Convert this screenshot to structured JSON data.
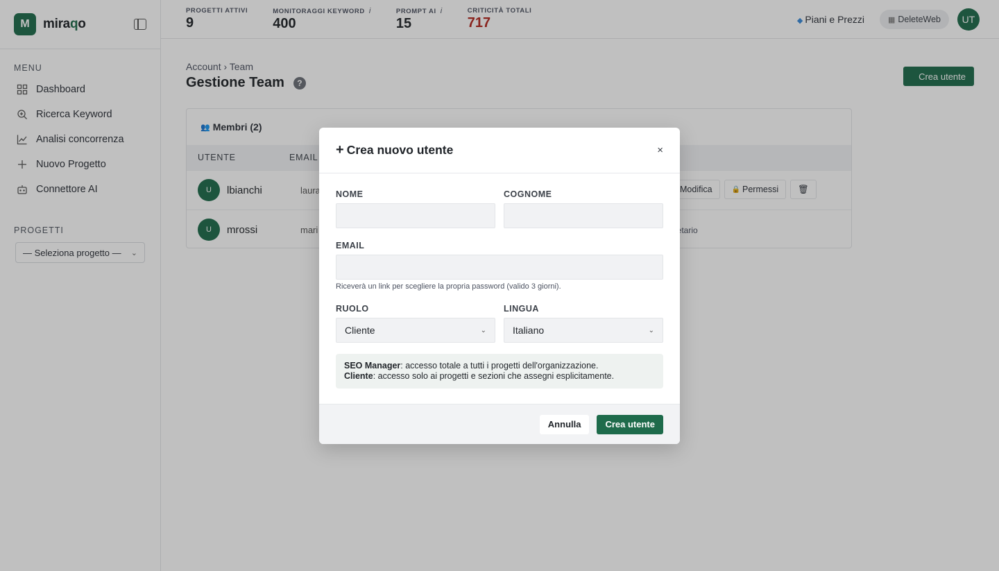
{
  "brand": {
    "logo_letter": "M",
    "name_prefix": "mira",
    "name_accent": "q",
    "name_suffix": "o",
    "accent_color": "#1e6b4b"
  },
  "sidebar": {
    "menu_label": "MENU",
    "items": [
      {
        "label": "Dashboard",
        "icon": "grid-icon"
      },
      {
        "label": "Ricerca Keyword",
        "icon": "search-plus-icon"
      },
      {
        "label": "Analisi concorrenza",
        "icon": "chart-line-icon"
      },
      {
        "label": "Nuovo Progetto",
        "icon": "plus-icon"
      },
      {
        "label": "Connettore AI",
        "icon": "robot-icon"
      }
    ],
    "projects_label": "PROGETTI",
    "project_select": "— Seleziona progetto —"
  },
  "topbar": {
    "stats": [
      {
        "label": "PROGETTI ATTIVI",
        "value": "9",
        "info": ""
      },
      {
        "label": "MONITORAGGI KEYWORD",
        "value": "400",
        "info": "i"
      },
      {
        "label": "PROMPT AI",
        "value": "15",
        "info": "i"
      },
      {
        "label": "CRITICITÀ TOTALI",
        "value": "717",
        "info": "",
        "color": "#b3261e"
      }
    ],
    "plans_label": "Piani e Prezzi",
    "workspace_label": "DeleteWeb",
    "avatar_initials": "UT"
  },
  "page": {
    "breadcrumb": "Account › Team",
    "title": "Gestione Team",
    "create_button": "Crea utente",
    "members_heading": "Membri (2)",
    "columns": [
      "UTENTE",
      "EMAIL"
    ],
    "rows": [
      {
        "initial": "U",
        "username": "lbianchi",
        "email_partial": "laura",
        "actions": [
          "Modifica",
          "Permessi"
        ]
      },
      {
        "initial": "U",
        "username": "mrossi",
        "email_partial": "mari",
        "role_partial": "rietario"
      }
    ]
  },
  "modal": {
    "title": "Crea nuovo utente",
    "close": "×",
    "fields": {
      "nome_label": "NOME",
      "nome_value": "",
      "cognome_label": "COGNOME",
      "cognome_value": "",
      "email_label": "EMAIL",
      "email_value": "",
      "email_hint": "Riceverà un link per scegliere la propria password (valido 3 giorni).",
      "ruolo_label": "RUOLO",
      "ruolo_value": "Cliente",
      "lingua_label": "LINGUA",
      "lingua_value": "Italiano"
    },
    "role_info": {
      "seo_term": "SEO Manager",
      "seo_desc": ": accesso totale a tutti i progetti dell'organizzazione.",
      "client_term": "Cliente",
      "client_desc": ": accesso solo ai progetti e sezioni che assegni esplicitamente."
    },
    "cancel_button": "Annulla",
    "submit_button": "Crea utente"
  }
}
